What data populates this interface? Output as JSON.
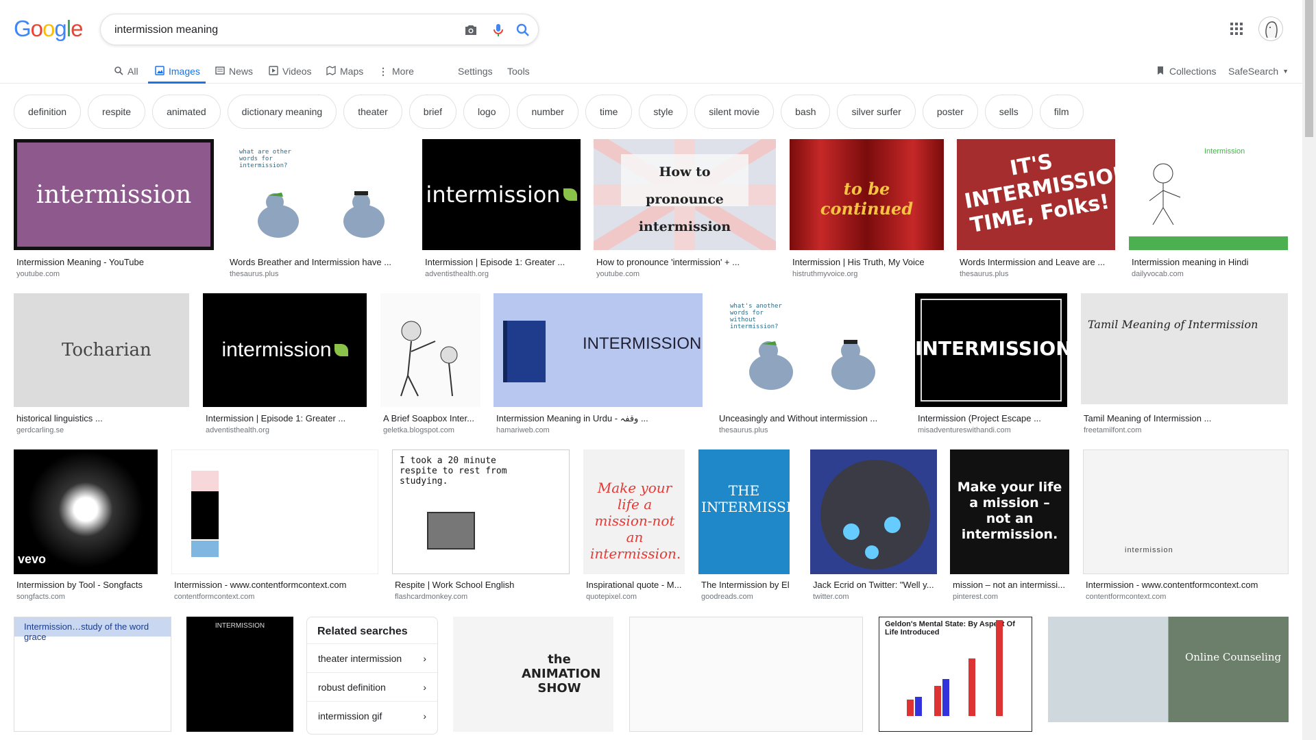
{
  "search": {
    "query": "intermission meaning"
  },
  "logo": [
    "G",
    "o",
    "o",
    "g",
    "l",
    "e"
  ],
  "tabs": [
    {
      "label": "All"
    },
    {
      "label": "Images"
    },
    {
      "label": "News"
    },
    {
      "label": "Videos"
    },
    {
      "label": "Maps"
    },
    {
      "label": "More"
    },
    {
      "label": "Settings"
    },
    {
      "label": "Tools"
    }
  ],
  "right_tools": {
    "collections": "Collections",
    "safesearch": "SafeSearch"
  },
  "chips": [
    "definition",
    "respite",
    "animated",
    "dictionary meaning",
    "theater",
    "brief",
    "logo",
    "number",
    "time",
    "style",
    "silent movie",
    "bash",
    "silver surfer",
    "poster",
    "sells",
    "film"
  ],
  "results": [
    {
      "title": "Intermission Meaning - YouTube",
      "source": "youtube.com",
      "thumb_text": "intermission"
    },
    {
      "title": "Words Breather and Intermission have ...",
      "source": "thesaurus.plus",
      "thumb_text": "what are other words for intermission?"
    },
    {
      "title": "Intermission | Episode 1: Greater ...",
      "source": "adventisthealth.org",
      "thumb_text": "intermission"
    },
    {
      "title": "How to pronounce 'intermission' + ...",
      "source": "youtube.com",
      "thumb_text": "How to pronounce intermission"
    },
    {
      "title": "Intermission | His Truth, My Voice",
      "source": "histruthmyvoice.org",
      "thumb_text": "to be continued"
    },
    {
      "title": "Words Intermission and Leave are ...",
      "source": "thesaurus.plus",
      "thumb_text": "IT'S INTERMISSION TIME, Folks!"
    },
    {
      "title": "Intermission meaning in Hindi",
      "source": "dailyvocab.com",
      "thumb_text": "Intermission"
    },
    {
      "title": "historical linguistics ...",
      "source": "gerdcarling.se",
      "thumb_text": "Tocharian"
    },
    {
      "title": "Intermission | Episode 1: Greater ...",
      "source": "adventisthealth.org",
      "thumb_text": "intermission"
    },
    {
      "title": "A Brief Soapbox Inter...",
      "source": "geletka.blogspot.com",
      "thumb_text": ""
    },
    {
      "title": "Intermission Meaning in Urdu - وقفہ ...",
      "source": "hamariweb.com",
      "thumb_text": "INTERMISSION"
    },
    {
      "title": "Unceasingly and Without intermission ...",
      "source": "thesaurus.plus",
      "thumb_text": "what's another words for without intermission?"
    },
    {
      "title": "Intermission (Project Escape ...",
      "source": "misadventureswithandi.com",
      "thumb_text": "INTERMISSION"
    },
    {
      "title": "Tamil Meaning of Intermission ...",
      "source": "freetamilfont.com",
      "thumb_text": "Tamil Meaning of Intermission"
    },
    {
      "title": "Intermission by Tool - Songfacts",
      "source": "songfacts.com",
      "thumb_text": "vevo"
    },
    {
      "title": "Intermission - www.contentformcontext.com",
      "source": "contentformcontext.com",
      "thumb_text": ""
    },
    {
      "title": "Respite | Work School English",
      "source": "flashcardmonkey.com",
      "thumb_text": "I took a 20 minute respite to rest from studying."
    },
    {
      "title": "Inspirational quote - M...",
      "source": "quotepixel.com",
      "thumb_text": "Make your life a mission-not an intermission."
    },
    {
      "title": "The Intermission by El...",
      "source": "goodreads.com",
      "thumb_text": "THE INTERMISSION"
    },
    {
      "title": "Jack Ecrid on Twitter: \"Well y...",
      "source": "twitter.com",
      "thumb_text": ""
    },
    {
      "title": "mission – not an intermissi...",
      "source": "pinterest.com",
      "thumb_text": "Make your life a mission – not an intermission."
    },
    {
      "title": "Intermission - www.contentformcontext.com",
      "source": "contentformcontext.com",
      "thumb_text": "intermission"
    },
    {
      "title": "",
      "source": "",
      "thumb_text": "Intermission…study of the word grace"
    },
    {
      "title": "",
      "source": "",
      "thumb_text": "INTERMISSION"
    },
    {
      "title": "",
      "source": "",
      "thumb_text": "the ANIMATION SHOW"
    },
    {
      "title": "",
      "source": "",
      "thumb_text": ""
    },
    {
      "title": "",
      "source": "",
      "thumb_text": "Geldon's Mental State: By Aspect Of Life Introduced"
    },
    {
      "title": "",
      "source": "",
      "thumb_text": "Online Counseling"
    }
  ],
  "related": {
    "heading": "Related searches",
    "items": [
      "theater intermission",
      "robust definition",
      "intermission gif"
    ]
  },
  "colors": {
    "blue": "#4285F4",
    "red": "#EA4335",
    "yellow": "#FBBC05",
    "green": "#34A853",
    "link": "#1a73e8"
  }
}
